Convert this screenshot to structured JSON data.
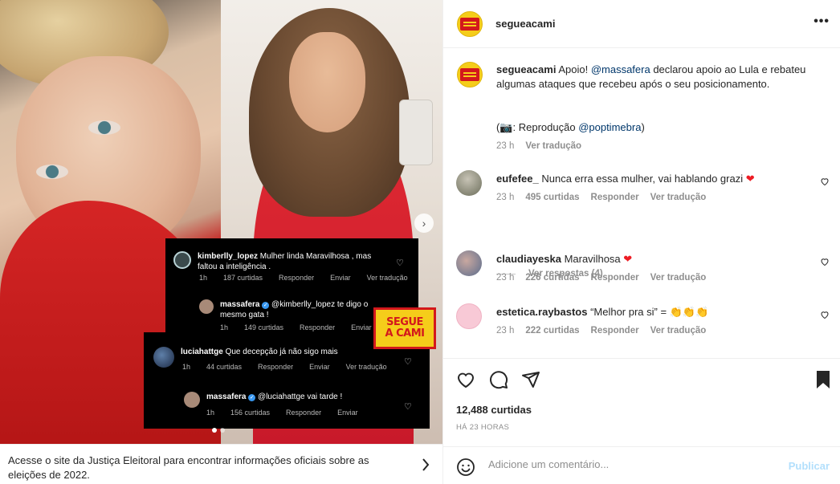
{
  "post": {
    "username": "segueacami",
    "caption_user": "segueacami",
    "caption_part1": " Apoio! ",
    "caption_mention": "@massafera",
    "caption_part2": " declarou apoio ao Lula e rebateu algumas ataques que recebeu após o seu posicionamento.",
    "caption_credit_prefix": "(📷: Reprodução ",
    "caption_credit_mention": "@poptimebra",
    "caption_credit_suffix": ")",
    "caption_time": "23 h",
    "caption_translate": "Ver tradução",
    "likes": "12,488 curtidas",
    "ago": "HÁ 23 HORAS"
  },
  "comments": [
    {
      "user": "eufefee_",
      "text": " Nunca erra essa mulher, vai hablando grazi ",
      "emoji": "❤",
      "time": "23 h",
      "likes": "495 curtidas",
      "reply": "Responder",
      "translate": "Ver tradução"
    },
    {
      "user": "claudiayeska",
      "text": " Maravilhosa ",
      "emoji": "❤",
      "time": "23 h",
      "likes": "226 curtidas",
      "reply": "Responder",
      "translate": "Ver tradução"
    },
    {
      "user": "estetica.raybastos",
      "text": " “Melhor pra si” = ",
      "emoji": "👏👏👏",
      "time": "23 h",
      "likes": "222 curtidas",
      "reply": "Responder",
      "translate": "Ver tradução"
    }
  ],
  "view_replies": "Ver respostas (4)",
  "add_comment": {
    "placeholder": "Adicione um comentário...",
    "publish": "Publicar"
  },
  "notice": {
    "text": "Acesse o site da Justiça Eleitoral para encontrar informações oficiais sobre as eleições de 2022."
  },
  "overlay": {
    "badge_line1": "SEGUE",
    "badge_line2": "A CAMI",
    "c1": {
      "user": "kimberlly_lopez",
      "text": " Mulher linda Maravilhosa , mas faltou a inteligência .",
      "time": "1h",
      "likes": "187 curtidas",
      "reply": "Responder",
      "send": "Enviar",
      "translate": "Ver tradução"
    },
    "c2": {
      "user": "massafera",
      "text": " @kimberlly_lopez te digo o mesmo gata !",
      "time": "1h",
      "likes": "149 curtidas",
      "reply": "Responder",
      "send": "Enviar"
    },
    "c3": {
      "user": "luciahattge",
      "text": " Que decepção já não sigo mais",
      "time": "1h",
      "likes": "44 curtidas",
      "reply": "Responder",
      "send": "Enviar",
      "translate": "Ver tradução"
    },
    "c4": {
      "user": "massafera",
      "text": " @luciahattge vai tarde !",
      "time": "1h",
      "likes": "156 curtidas",
      "reply": "Responder",
      "send": "Enviar"
    }
  },
  "icons": {
    "like": "heart-icon",
    "comment": "comment-icon",
    "share": "send-icon",
    "save": "bookmark-icon",
    "emoji": "smiley-icon",
    "more": "more-icon",
    "next": "chevron-right-icon"
  },
  "colors": {
    "accent_link": "#00376b",
    "publish_disabled": "#b2dffc",
    "brand_yellow": "#f5cd1a",
    "brand_red": "#d3181c"
  }
}
